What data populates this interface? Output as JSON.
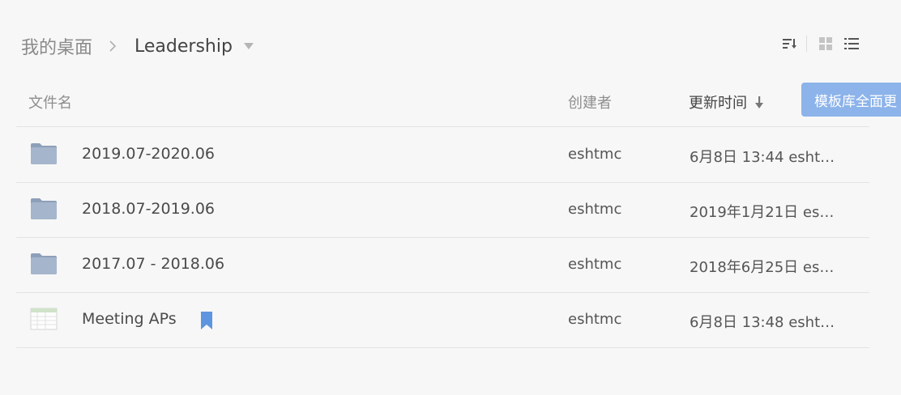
{
  "breadcrumb": {
    "root": "我的桌面",
    "current": "Leadership"
  },
  "toolbar": {
    "icons": [
      "sort-icon",
      "grid-view-icon",
      "list-view-icon"
    ]
  },
  "table": {
    "headers": {
      "name": "文件名",
      "creator": "创建者",
      "updated": "更新时间"
    },
    "rows": [
      {
        "type": "folder",
        "name": "2019.07-2020.06",
        "creator": "eshtmc",
        "updated": "6月8日 13:44 esht…"
      },
      {
        "type": "folder",
        "name": "2018.07-2019.06",
        "creator": "eshtmc",
        "updated": "2019年1月21日 es…"
      },
      {
        "type": "folder",
        "name": "2017.07 - 2018.06",
        "creator": "eshtmc",
        "updated": "2018年6月25日 es…"
      },
      {
        "type": "sheet",
        "name": "Meeting APs",
        "creator": "eshtmc",
        "updated": "6月8日 13:48 esht…",
        "bookmarked": true
      }
    ]
  },
  "template_button": {
    "label": "模板库全面更"
  },
  "colors": {
    "background": "#f7f7f7",
    "accent": "#8cb3ea",
    "bookmark": "#5d95e0",
    "folder": "#9fb0c8"
  }
}
